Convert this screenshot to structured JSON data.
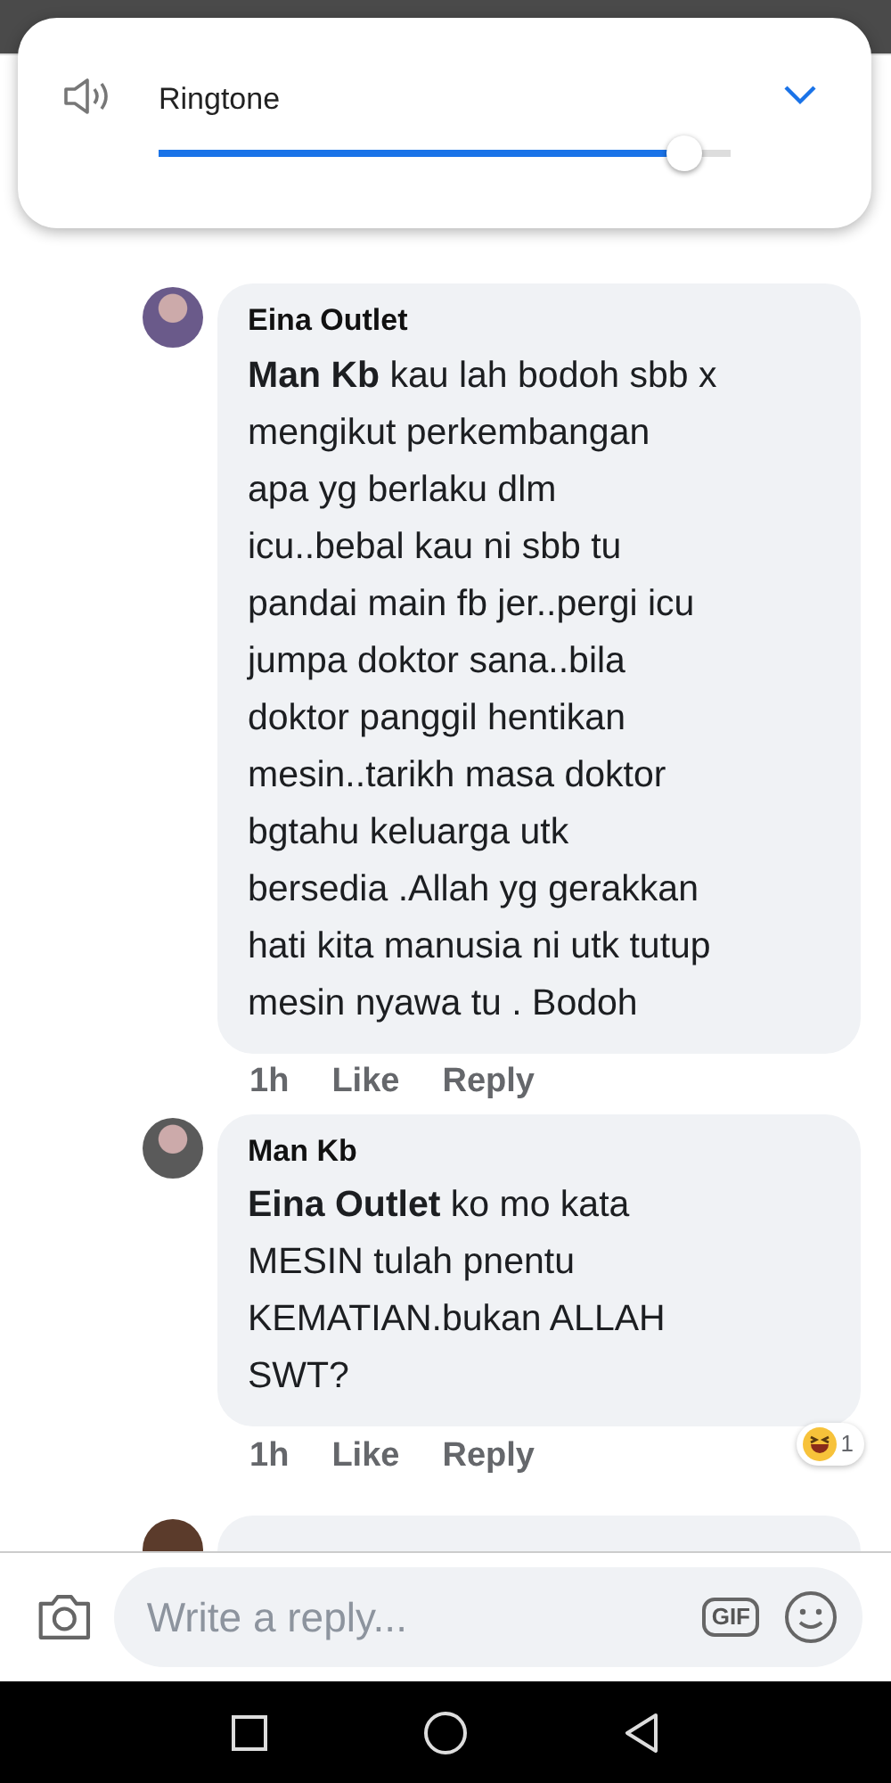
{
  "volume_popup": {
    "label": "Ringtone",
    "level": 0.92
  },
  "comments": [
    {
      "author": "Eina Outlet",
      "text": "**Man Kb** kau lah bodoh sbb x\nmengikut perkembangan\napa yg berlaku dlm\nicu..bebal kau ni sbb tu\npandai main fb jer..pergi icu\njumpa doktor sana..bila\ndoktor panggil hentikan\nmesin..tarikh masa doktor\nbgtahu keluarga utk\nbersedia .Allah yg gerakkan\nhati kita manusia ni utk tutup\nmesin nyawa tu . Bodoh",
      "time": "1h",
      "like": "Like",
      "reply": "Reply"
    },
    {
      "author": "Man Kb",
      "text": "**Eina Outlet** ko mo kata\nMESIN tulah pnentu\nKEMATIAN.bukan ALLAH\nSWT?",
      "time": "1h",
      "like": "Like",
      "reply": "Reply",
      "reaction_count": "1"
    }
  ],
  "reply_bar": {
    "placeholder": "Write a reply...",
    "gif_label": "GIF"
  }
}
